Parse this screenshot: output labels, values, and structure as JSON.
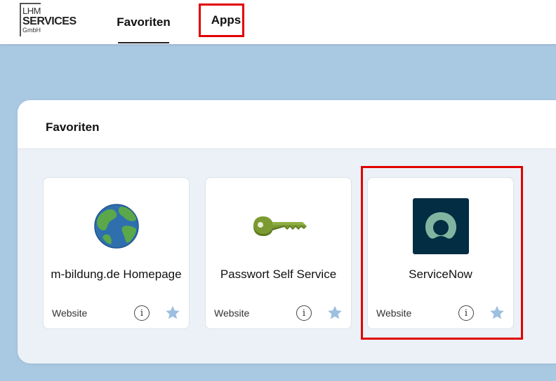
{
  "header": {
    "logo": {
      "line1": "LHM",
      "line2": "SERVICES",
      "line3": "GmbH"
    },
    "tabs": [
      {
        "label": "Favoriten",
        "active": true
      },
      {
        "label": "Apps",
        "active": false
      }
    ]
  },
  "favorites": {
    "title": "Favoriten",
    "cards": [
      {
        "name": "m-bildung.de Homepage",
        "type": "Website",
        "icon": "globe-icon",
        "favorite": true
      },
      {
        "name": "Passwort Self Service",
        "type": "Website",
        "icon": "key-icon",
        "favorite": true
      },
      {
        "name": "ServiceNow",
        "type": "Website",
        "icon": "servicenow-logo-icon",
        "favorite": true
      }
    ]
  },
  "colors": {
    "page_background": "#a9c8e2",
    "highlight": "#e10000",
    "star": "#9dbfe0",
    "servicenow_bg": "#032d42",
    "servicenow_green": "#81b5a1"
  }
}
